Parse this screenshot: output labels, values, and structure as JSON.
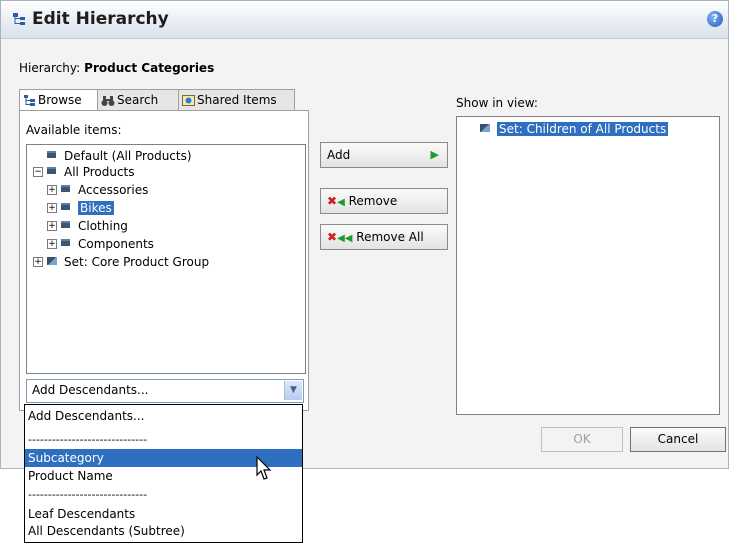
{
  "dialog": {
    "title": "Edit Hierarchy",
    "help_icon": "help-icon",
    "hierarchy_label": "Hierarchy:",
    "hierarchy_name": "Product Categories"
  },
  "tabs": [
    {
      "label": "Browse",
      "icon": "browse-icon"
    },
    {
      "label": "Search",
      "icon": "binoculars-icon"
    },
    {
      "label": "Shared Items",
      "icon": "shared-items-icon"
    }
  ],
  "left": {
    "available_label": "Available items:",
    "tree": [
      {
        "label": "Default (All Products)"
      },
      {
        "label": "All Products",
        "expander": "−"
      },
      {
        "label": "Accessories",
        "expander": "+"
      },
      {
        "label": "Bikes",
        "expander": "+",
        "selected": true
      },
      {
        "label": "Clothing",
        "expander": "+"
      },
      {
        "label": "Components",
        "expander": "+"
      },
      {
        "label": "Set: Core Product Group",
        "expander": "+"
      }
    ],
    "combo_value": "Add Descendants..."
  },
  "buttons": {
    "add": "Add",
    "remove": "Remove",
    "remove_all": "Remove All",
    "ok": "OK",
    "cancel": "Cancel"
  },
  "right": {
    "show_label": "Show in view:",
    "items": [
      {
        "label": "Set: Children of All Products",
        "selected": true
      }
    ]
  },
  "dropdown": {
    "options": [
      "Add Descendants...",
      "------------------------------",
      "Subcategory",
      "Product Name",
      "------------------------------",
      "Leaf Descendants",
      "All Descendants (Subtree)"
    ],
    "highlighted": "Subcategory"
  },
  "colors": {
    "selection": "#2f6fc0",
    "add_arrow": "#1e9b2c",
    "remove_x": "#d21f1f"
  }
}
